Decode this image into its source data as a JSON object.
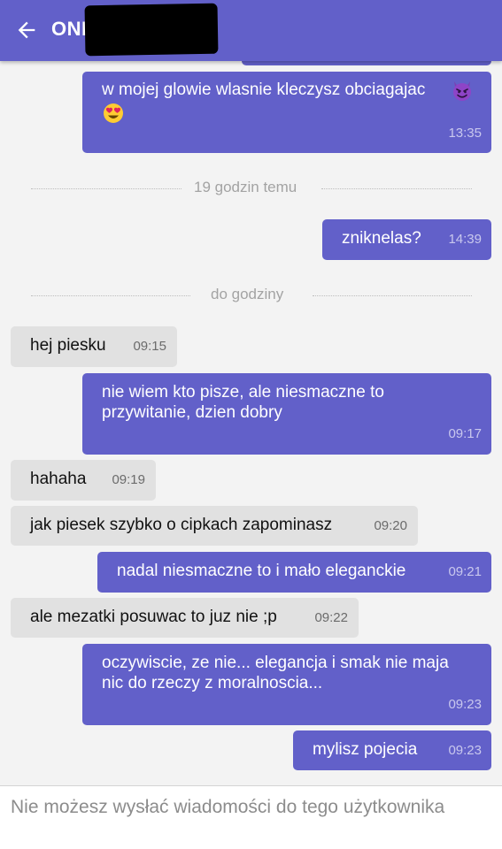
{
  "header": {
    "title": "ONI",
    "back_icon": "arrow-left-icon",
    "color": "#6260c9"
  },
  "separators": [
    {
      "label": "19 godzin temu"
    },
    {
      "label": "do godziny"
    }
  ],
  "messages": [
    {
      "direction": "out",
      "line1": "w mojej glowie wlasnie kleczysz obciagajac",
      "time": "13:35",
      "emojis": [
        "smiling-devil-emoji",
        "heart-eyes-emoji"
      ]
    },
    {
      "direction": "out",
      "text": "zniknelas?",
      "time": "14:39"
    },
    {
      "direction": "in",
      "text": "hej piesku",
      "time": "09:15"
    },
    {
      "direction": "out",
      "line1": "nie wiem kto pisze, ale niesmaczne to",
      "line2": "przywitanie, dzien dobry",
      "time": "09:17"
    },
    {
      "direction": "in",
      "text": "hahaha",
      "time": "09:19"
    },
    {
      "direction": "in",
      "text": "jak piesek szybko o cipkach zapominasz",
      "time": "09:20"
    },
    {
      "direction": "out",
      "text": "nadal niesmaczne to i mało eleganckie",
      "time": "09:21"
    },
    {
      "direction": "in",
      "text": "ale mezatki posuwac to juz nie ;p",
      "time": "09:22"
    },
    {
      "direction": "out",
      "line1": "oczywiscie, ze nie... elegancja i smak nie maja",
      "line2": "nic do rzeczy z moralnoscia...",
      "time": "09:23"
    },
    {
      "direction": "out",
      "text": "mylisz pojecia",
      "time": "09:23"
    }
  ],
  "footer": {
    "notice": "Nie możesz wysłać wiadomości do tego użytkownika"
  },
  "colors": {
    "outgoing_bubble": "#6260c9",
    "incoming_bubble": "#e1e1e1",
    "background": "#f3f3f3"
  }
}
